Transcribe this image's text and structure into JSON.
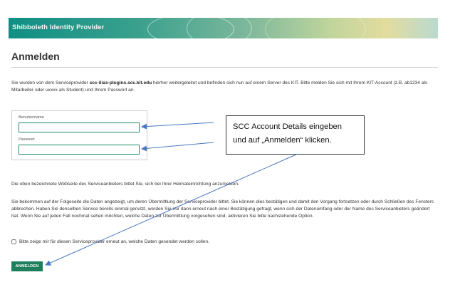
{
  "header": {
    "title": "Shibboleth Identity Provider"
  },
  "page": {
    "title": "Anmelden"
  },
  "intro": {
    "before": "Sie wurden von dem Serviceprovider ",
    "provider": "scc-ilias-plugins.scc.kit.edu",
    "after": " hierher weitergeleitet und befinden sich nun auf einem Server des KIT. Bitte melden Sie sich mit Ihrem KIT-Account (z.B. ab1234 als Mitarbeiter oder uxxxx als Student) und Ihrem Passwort an."
  },
  "form": {
    "username_label": "Benutzername",
    "username_value": "",
    "password_label": "Passwort",
    "password_value": ""
  },
  "callout": {
    "line1": "SCC Account Details eingeben",
    "line2": "und auf „Anmelden“ klicken."
  },
  "paragraphs": {
    "p1": "Die oben bezeichnete Webseite des Serviceanbieters bittet Sie, sich bei Ihrer Heimateinrichtung anzumelden.",
    "p2": "Sie bekommen auf der Folgeseite die Daten angezeigt, um deren Übermittlung der Serviceprovider bittet. Sie können dies bestätigen und damit den Vorgang fortsetzen oder durch Schließen des Fensters abbrechen. Haben Sie denselben Service bereits einmal genutzt, werden Sie nur dann erneut nach einer Bestätigung gefragt, wenn sich der Datenumfang oder der Name des Serviceanbieters geändert hat. Wenn Sie auf jeden Fall nochmal sehen möchten, welche Daten zur Übermittlung vorgesehen sind, aktivieren Sie bitte nachstehende Option."
  },
  "consent": {
    "label": "Bitte zeige mir für diesen Serviceprovider erneut an, welche Daten gesendet werden sollen.",
    "checked": false
  },
  "login_button": {
    "label": "ANMELDEN"
  },
  "colors": {
    "accent": "#1e7f5c",
    "field_border": "#1d8a66",
    "arrow": "#4a78c0"
  }
}
